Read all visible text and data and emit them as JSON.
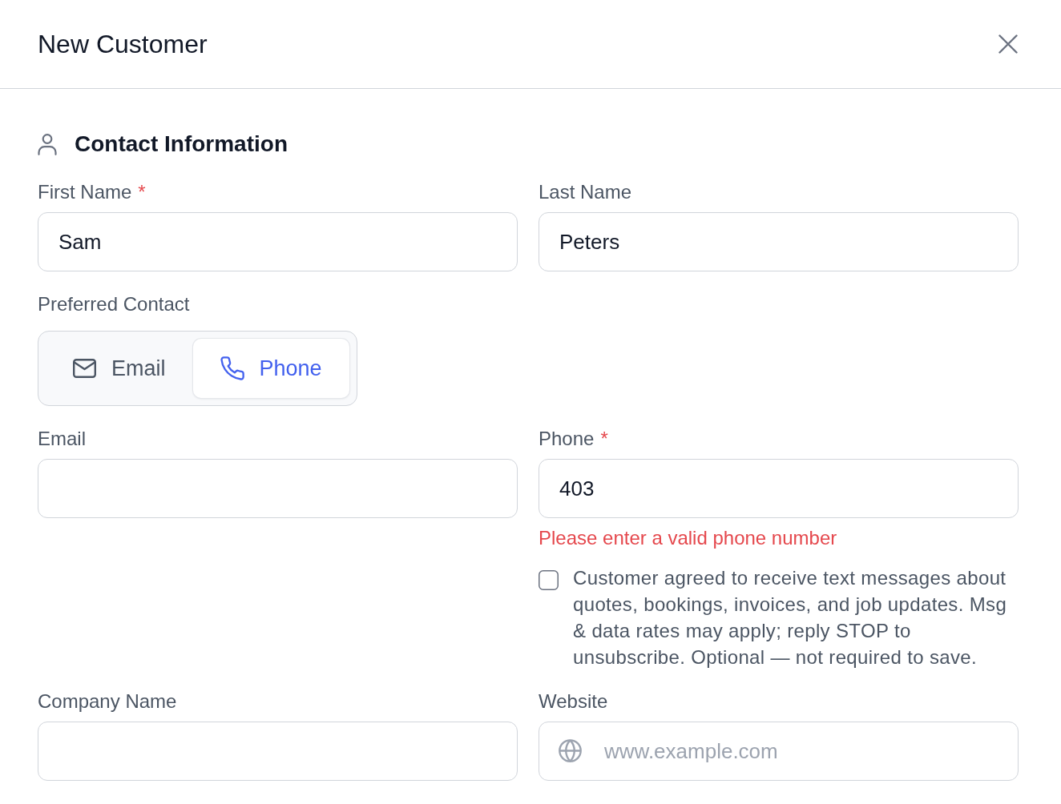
{
  "header": {
    "title": "New Customer"
  },
  "contact_section": {
    "title": "Contact Information",
    "name_row": [
      {
        "label": "First Name",
        "required_mark": "*",
        "value": "Sam"
      },
      {
        "label": "Last Name",
        "value": "Peters"
      }
    ],
    "preferred_contact": {
      "label": "Preferred Contact",
      "options": [
        {
          "kind": "email",
          "label": "Email",
          "selected": false
        },
        {
          "kind": "phone",
          "label": "Phone",
          "selected": true
        }
      ]
    },
    "reach_row": [
      {
        "label": "Email"
      },
      {
        "label": "Phone",
        "required_mark": "*",
        "value": "403",
        "error": "Please enter a valid phone number",
        "sms_consent": {
          "checked": false,
          "text": "Customer agreed to receive text messages about quotes, bookings, invoices, and job updates. Msg & data rates may apply; reply STOP to unsubscribe. Optional — not required to save."
        }
      }
    ],
    "company_row": [
      {
        "kind": "text",
        "label": "Company Name"
      },
      {
        "kind": "url",
        "label": "Website",
        "placeholder": "www.example.com"
      }
    ]
  }
}
